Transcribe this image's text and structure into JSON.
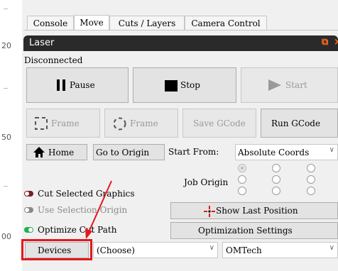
{
  "ruler": {
    "labels": [
      "20",
      "50",
      "00"
    ]
  },
  "tabs": [
    {
      "label": "Console"
    },
    {
      "label": "Move"
    },
    {
      "label": "Cuts / Layers"
    },
    {
      "label": "Camera Control"
    }
  ],
  "panel": {
    "title": "Laser",
    "icons": [
      "restore-icon",
      "close-icon"
    ],
    "restore_glyph": "⧉",
    "close_glyph": "×"
  },
  "status": "Disconnected",
  "buttons": {
    "pause": "Pause",
    "stop": "Stop",
    "start": "Start",
    "frame_rect": "Frame",
    "frame_circle": "Frame",
    "save_gcode": "Save GCode",
    "run_gcode": "Run GCode",
    "home": "Home",
    "go_to_origin": "Go to Origin",
    "show_last_position": "Show Last Position",
    "optimization_settings": "Optimization Settings",
    "devices": "Devices"
  },
  "start_from": {
    "label": "Start From:",
    "value": "Absolute Coords"
  },
  "job_origin": {
    "label": "Job Origin"
  },
  "options": {
    "cut_selected": {
      "label": "Cut Selected Graphics",
      "state": "off"
    },
    "use_selection_origin": {
      "label": "Use Selection Origin",
      "state": "disabled"
    },
    "optimize_cut_path": {
      "label": "Optimize Cut Path",
      "state": "on"
    }
  },
  "device_select": {
    "value": "(Choose)"
  },
  "profile_select": {
    "value": "OMTech"
  },
  "colors": {
    "accent": "#ff6b1a",
    "annotation": "#e4171c",
    "toggle_on": "#1db24a",
    "toggle_off": "#7a2020"
  }
}
